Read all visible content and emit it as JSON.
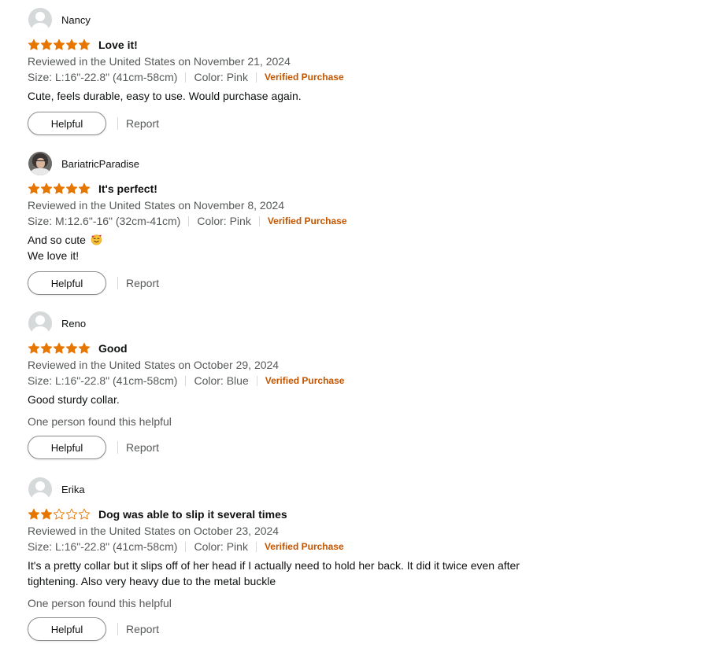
{
  "colors": {
    "star": "#e77600",
    "verified": "#c45500",
    "meta_text": "#565959"
  },
  "reviews": [
    {
      "name": "Nancy",
      "avatar": "default-avatar-icon",
      "rating": 5,
      "title": "Love it!",
      "date": "Reviewed in the United States on November 21, 2024",
      "size": "Size: L:16\"-22.8\" (41cm-58cm)",
      "color": "Color: Pink",
      "verified": "Verified Purchase",
      "body": [
        "Cute, feels durable, easy to use. Would purchase again."
      ],
      "helpful_count": "",
      "helpful_label": "Helpful",
      "report_label": "Report"
    },
    {
      "name": "BariatricParadise",
      "avatar": "profile-photo",
      "rating": 5,
      "title": "It's perfect!",
      "date": "Reviewed in the United States on November 8, 2024",
      "size": "Size: M:12.6\"-16\" (32cm-41cm)",
      "color": "Color: Pink",
      "verified": "Verified Purchase",
      "body": [
        "And so cute",
        "We love it!"
      ],
      "body_emoji": "smiling-face-with-hearts-emoji",
      "helpful_count": "",
      "helpful_label": "Helpful",
      "report_label": "Report"
    },
    {
      "name": "Reno",
      "avatar": "default-avatar-icon",
      "rating": 5,
      "title": "Good",
      "date": "Reviewed in the United States on October 29, 2024",
      "size": "Size: L:16\"-22.8\" (41cm-58cm)",
      "color": "Color: Blue",
      "verified": "Verified Purchase",
      "body": [
        "Good sturdy collar."
      ],
      "helpful_count": "One person found this helpful",
      "helpful_label": "Helpful",
      "report_label": "Report"
    },
    {
      "name": "Erika",
      "avatar": "default-avatar-icon",
      "rating": 2,
      "title": "Dog was able to slip it several times",
      "date": "Reviewed in the United States on October 23, 2024",
      "size": "Size: L:16\"-22.8\" (41cm-58cm)",
      "color": "Color: Pink",
      "verified": "Verified Purchase",
      "body": [
        "It's a pretty collar but it slips off of her head if I actually need to hold her back. It did it twice even after tightening. Also very heavy due to the metal buckle"
      ],
      "helpful_count": "One person found this helpful",
      "helpful_label": "Helpful",
      "report_label": "Report"
    }
  ]
}
